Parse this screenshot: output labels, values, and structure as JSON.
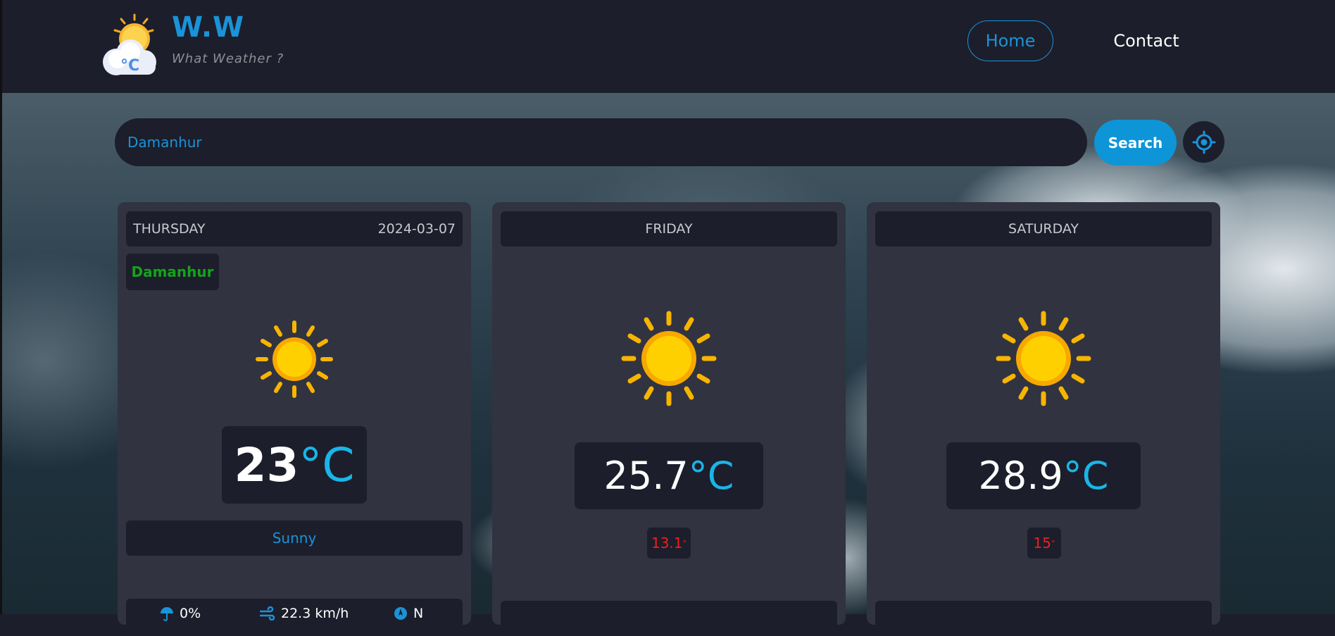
{
  "brand": {
    "title": "W.W",
    "subtitle": "What Weather ?",
    "logo_icon": "sun-cloud-celsius-icon",
    "logo_badge": "°C"
  },
  "nav": {
    "home": "Home",
    "contact": "Contact"
  },
  "search": {
    "value": "Damanhur",
    "button_label": "Search",
    "locate_icon": "crosshair-locate-icon"
  },
  "colors": {
    "accent": "#1a93d8",
    "panel": "#1c1e2b",
    "card": "#313341",
    "city": "#15a21b",
    "min_temp": "#f01f1f",
    "unit": "#1ab5e8"
  },
  "cards": [
    {
      "day": "THURSDAY",
      "date": "2024-03-07",
      "city": "Damanhur",
      "icon": "sun-icon",
      "temp": "23",
      "unit": "°C",
      "condition": "Sunny",
      "stats": {
        "rain": "0%",
        "wind": "22.3 km/h",
        "direction": "N"
      }
    },
    {
      "day": "FRIDAY",
      "icon": "sun-icon",
      "temp": "25.7",
      "unit": "°C",
      "min_temp": "13.1",
      "min_unit": "°"
    },
    {
      "day": "SATURDAY",
      "icon": "sun-icon",
      "temp": "28.9",
      "unit": "°C",
      "min_temp": "15",
      "min_unit": "°"
    }
  ]
}
